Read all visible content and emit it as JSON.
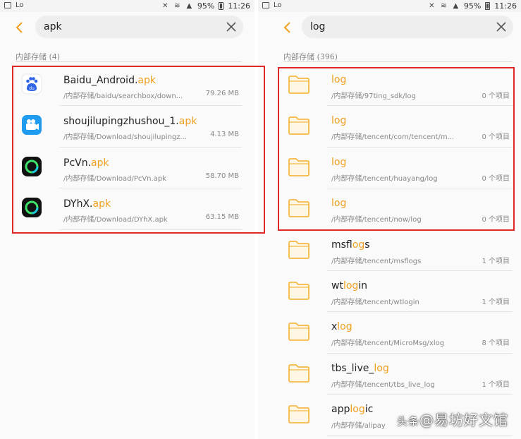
{
  "left": {
    "status": {
      "battery": "95%",
      "time": "11:26"
    },
    "search": {
      "query": "apk"
    },
    "section": "内部存储 (4)",
    "items": [
      {
        "name": "Baidu_Android.",
        "match": "apk",
        "path": "/内部存储/baidu/searchbox/down...",
        "size": "79.26 MB",
        "icon": "baidu-icon"
      },
      {
        "name": "shoujilupingzhushou_1.",
        "match": "apk",
        "path": "/内部存储/Download/shoujilupingz...",
        "size": "4.13 MB",
        "icon": "video-camera-icon"
      },
      {
        "name": "PcVn.",
        "match": "apk",
        "path": "/内部存储/Download/PcVn.apk",
        "size": "58.70 MB",
        "icon": "ring-app-icon"
      },
      {
        "name": "DYhX.",
        "match": "apk",
        "path": "/内部存储/Download/DYhX.apk",
        "size": "63.15 MB",
        "icon": "ring-app-icon"
      }
    ]
  },
  "right": {
    "status": {
      "battery": "95%",
      "time": "11:26"
    },
    "search": {
      "query": "log"
    },
    "section": "内部存储 (396)",
    "items": [
      {
        "pre": "",
        "match": "log",
        "post": "",
        "path": "/内部存储/97ting_sdk/log",
        "count": "0 个项目"
      },
      {
        "pre": "",
        "match": "log",
        "post": "",
        "path": "/内部存储/tencent/com/tencent/m...",
        "count": "0 个项目"
      },
      {
        "pre": "",
        "match": "log",
        "post": "",
        "path": "/内部存储/tencent/huayang/log",
        "count": "0 个项目"
      },
      {
        "pre": "",
        "match": "log",
        "post": "",
        "path": "/内部存储/tencent/now/log",
        "count": "0 个项目"
      },
      {
        "pre": "msf",
        "match": "log",
        "post": "s",
        "path": "/内部存储/tencent/msflogs",
        "count": "1 个项目"
      },
      {
        "pre": "wt",
        "match": "log",
        "post": "in",
        "path": "/内部存储/tencent/wtlogin",
        "count": "1 个项目"
      },
      {
        "pre": "x",
        "match": "log",
        "post": "",
        "path": "/内部存储/tencent/MicroMsg/xlog",
        "count": "8 个项目"
      },
      {
        "pre": "tbs_live_",
        "match": "log",
        "post": "",
        "path": "/内部存储/tencent/tbs_live_log",
        "count": "1 个项目"
      },
      {
        "pre": "app",
        "match": "log",
        "post": "ic",
        "path": "/内部存储/alipay",
        "count": ""
      }
    ]
  },
  "watermark": {
    "prefix": "头条",
    "name": "@易坊好文馆"
  },
  "colors": {
    "highlight": "#f0a020",
    "red_box": "#e12828",
    "folder": "#f5b945",
    "accent_back": "#f0a020"
  }
}
